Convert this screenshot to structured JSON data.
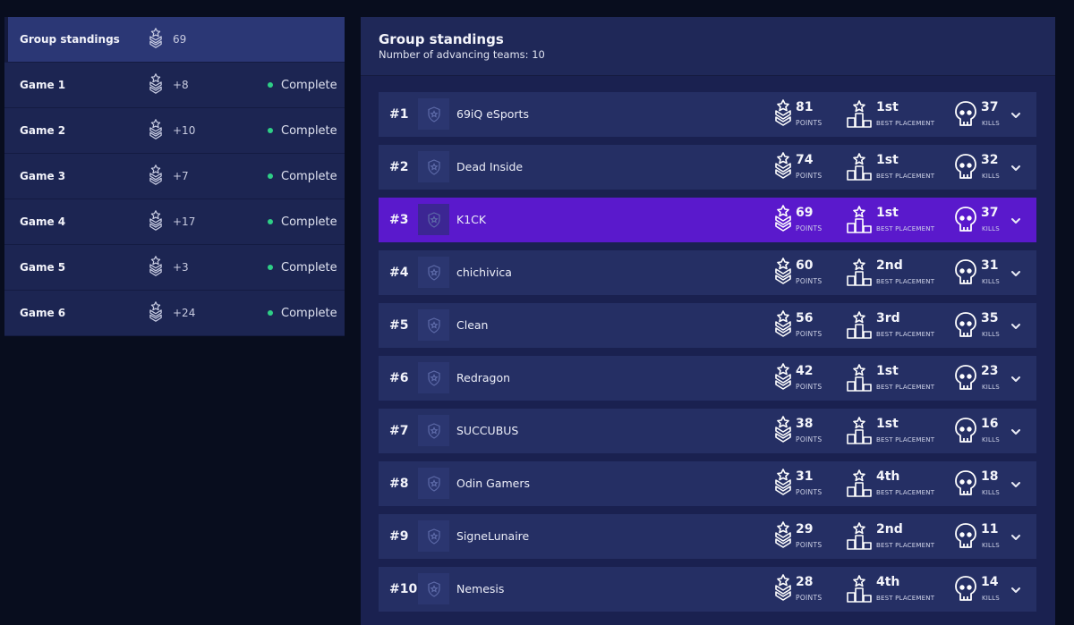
{
  "sidebar": {
    "items": [
      {
        "label": "Group standings",
        "value": "69",
        "status": ""
      },
      {
        "label": "Game 1",
        "value": "+8",
        "status": "Complete"
      },
      {
        "label": "Game 2",
        "value": "+10",
        "status": "Complete"
      },
      {
        "label": "Game 3",
        "value": "+7",
        "status": "Complete"
      },
      {
        "label": "Game 4",
        "value": "+17",
        "status": "Complete"
      },
      {
        "label": "Game 5",
        "value": "+3",
        "status": "Complete"
      },
      {
        "label": "Game 6",
        "value": "+24",
        "status": "Complete"
      }
    ],
    "active_index": 0
  },
  "panel": {
    "title": "Group standings",
    "subtitle": "Number of advancing teams: 10"
  },
  "stat_labels": {
    "points": "POINTS",
    "placement": "BEST PLACEMENT",
    "kills": "KILLS"
  },
  "teams": [
    {
      "rank": "#1",
      "name": "69iQ eSports",
      "points": "81",
      "placement": "1st",
      "kills": "37"
    },
    {
      "rank": "#2",
      "name": "Dead Inside",
      "points": "74",
      "placement": "1st",
      "kills": "32"
    },
    {
      "rank": "#3",
      "name": "K1CK",
      "points": "69",
      "placement": "1st",
      "kills": "37"
    },
    {
      "rank": "#4",
      "name": "chichivica",
      "points": "60",
      "placement": "2nd",
      "kills": "31"
    },
    {
      "rank": "#5",
      "name": "Clean",
      "points": "56",
      "placement": "3rd",
      "kills": "35"
    },
    {
      "rank": "#6",
      "name": "Redragon",
      "points": "42",
      "placement": "1st",
      "kills": "23"
    },
    {
      "rank": "#7",
      "name": "SUCCUBUS",
      "points": "38",
      "placement": "1st",
      "kills": "16"
    },
    {
      "rank": "#8",
      "name": "Odin Gamers",
      "points": "31",
      "placement": "4th",
      "kills": "18"
    },
    {
      "rank": "#9",
      "name": "SigneLunaire",
      "points": "29",
      "placement": "2nd",
      "kills": "11"
    },
    {
      "rank": "#10",
      "name": "Nemesis",
      "points": "28",
      "placement": "4th",
      "kills": "14"
    }
  ],
  "highlighted_team": "K1CK",
  "colors": {
    "background": "#080d1e",
    "panel": "#1a2150",
    "row": "#252f64",
    "highlight": "#5a19cc",
    "status_dot": "#2ecf86"
  },
  "icons": {
    "points": "chevron-badge-star-icon",
    "placement": "podium-icon",
    "kills": "skull-icon",
    "team_logo": "shield-placeholder-icon",
    "expand": "chevron-down-icon"
  }
}
